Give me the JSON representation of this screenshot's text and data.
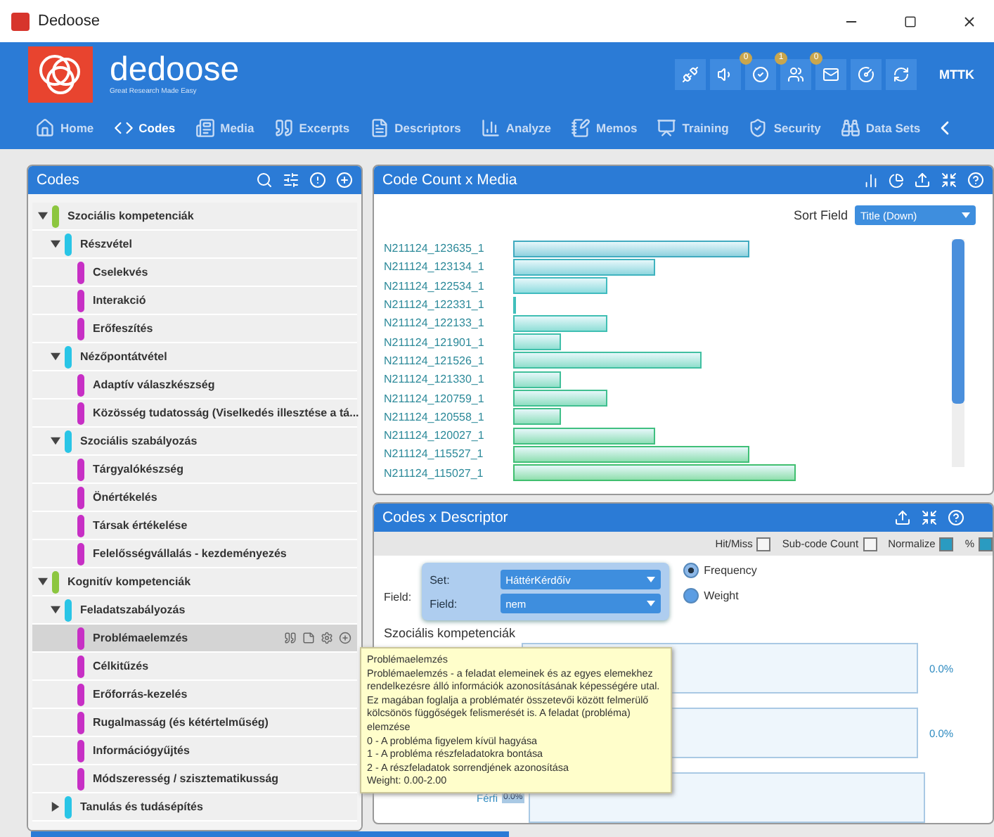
{
  "window": {
    "title": "Dedoose"
  },
  "app": {
    "logo_text": "dedoose",
    "tagline": "Great Research Made Easy",
    "notifications": [
      {
        "badge": "0"
      },
      {
        "badge": "1"
      },
      {
        "badge": "0"
      }
    ],
    "user": "MTTK"
  },
  "nav": [
    {
      "label": "Home",
      "selected": false
    },
    {
      "label": "Codes",
      "selected": true
    },
    {
      "label": "Media",
      "selected": false
    },
    {
      "label": "Excerpts",
      "selected": false
    },
    {
      "label": "Descriptors",
      "selected": false
    },
    {
      "label": "Analyze",
      "selected": false
    },
    {
      "label": "Memos",
      "selected": false
    },
    {
      "label": "Training",
      "selected": false
    },
    {
      "label": "Security",
      "selected": false
    },
    {
      "label": "Data Sets",
      "selected": false
    }
  ],
  "codes_panel": {
    "title": "Codes",
    "tree": [
      {
        "label": "Szociális kompetenciák",
        "color": "#8cc63f",
        "expanded": true,
        "selected": false,
        "children": [
          {
            "label": "Részvétel",
            "color": "#29c5e6",
            "expanded": true,
            "selected": false,
            "children": [
              {
                "label": "Cselekvés",
                "color": "#c72fc5",
                "selected": false
              },
              {
                "label": "Interakció",
                "color": "#c72fc5",
                "selected": false
              },
              {
                "label": "Erőfeszítés",
                "color": "#c72fc5",
                "selected": false
              }
            ]
          },
          {
            "label": "Nézőpontátvétel",
            "color": "#29c5e6",
            "expanded": true,
            "selected": false,
            "children": [
              {
                "label": "Adaptív válaszkészség",
                "color": "#c72fc5",
                "selected": false
              },
              {
                "label": "Közösség tudatosság (Viselkedés illesztése a tá...",
                "color": "#c72fc5",
                "selected": false
              }
            ]
          },
          {
            "label": "Szociális szabályozás",
            "color": "#29c5e6",
            "expanded": true,
            "selected": false,
            "children": [
              {
                "label": "Tárgyalókészség",
                "color": "#c72fc5",
                "selected": false
              },
              {
                "label": "Önértékelés",
                "color": "#c72fc5",
                "selected": false
              },
              {
                "label": "Társak értékelése",
                "color": "#c72fc5",
                "selected": false
              },
              {
                "label": "Felelősségvállalás - kezdeményezés",
                "color": "#c72fc5",
                "selected": false
              }
            ]
          }
        ]
      },
      {
        "label": "Kognitív kompetenciák",
        "color": "#8cc63f",
        "expanded": true,
        "selected": false,
        "children": [
          {
            "label": "Feladatszabályozás",
            "color": "#29c5e6",
            "expanded": true,
            "selected": false,
            "children": [
              {
                "label": "Problémaelemzés",
                "color": "#c72fc5",
                "selected": true
              },
              {
                "label": "Célkitűzés",
                "color": "#c72fc5",
                "selected": false
              },
              {
                "label": "Erőforrás-kezelés",
                "color": "#c72fc5",
                "selected": false
              },
              {
                "label": "Rugalmasság (és kétértelműség)",
                "color": "#c72fc5",
                "selected": false
              },
              {
                "label": "Információgyűjtés",
                "color": "#c72fc5",
                "selected": false
              },
              {
                "label": "Módszeresség / szisztematikusság",
                "color": "#c72fc5",
                "selected": false
              }
            ]
          },
          {
            "label": "Tanulás és tudásépítés",
            "color": "#29c5e6",
            "expanded": false,
            "selected": false
          }
        ]
      }
    ]
  },
  "chart_panel": {
    "title": "Code Count x Media",
    "sort_label": "Sort Field",
    "sort_value": "Title (Down)",
    "media": [
      "N211124_123635_1",
      "N211124_123134_1",
      "N211124_122534_1",
      "N211124_122331_1",
      "N211124_122133_1",
      "N211124_121901_1",
      "N211124_121526_1",
      "N211124_121330_1",
      "N211124_120759_1",
      "N211124_120558_1",
      "N211124_120027_1",
      "N211124_115527_1",
      "N211124_115027_1"
    ]
  },
  "descriptor_panel": {
    "title": "Codes x Descriptor",
    "options": [
      {
        "label": "Hit/Miss",
        "checked": false
      },
      {
        "label": "Sub-code Count",
        "checked": false
      },
      {
        "label": "Normalize",
        "checked": true
      },
      {
        "label": "%",
        "checked": true
      }
    ],
    "field_label": "Field:",
    "set_label": "Set:",
    "set_value": "HáttérKérdőív",
    "field2_label": "Field:",
    "field_value": "nem",
    "modes": [
      {
        "label": "Frequency",
        "selected": true
      },
      {
        "label": "Weight",
        "selected": false
      }
    ],
    "group_title": "Szociális kompetenciák",
    "rows": [
      {
        "value": "0.0%"
      },
      {
        "value": "0.0%"
      }
    ],
    "partial_row": {
      "label": "Férfi",
      "value": "0.0%"
    }
  },
  "tooltip": {
    "title": "Problémaelemzés",
    "description": "Problémaelemzés - a feladat elemeinek és az egyes elemekhez rendelkezésre álló információk azonosításának képességére utal. Ez magában foglalja a problématér összetevői között felmerülő kölcsönös függőségek felismerését is. A feladat (probléma) elemzése",
    "levels": [
      "0 - A probléma figyelem kívül hagyása",
      "1 - A probléma részfeladatokra bontása",
      "2 - A részfeladatok sorrendjének azonosítása"
    ],
    "weight": "Weight: 0.00-2.00"
  }
}
